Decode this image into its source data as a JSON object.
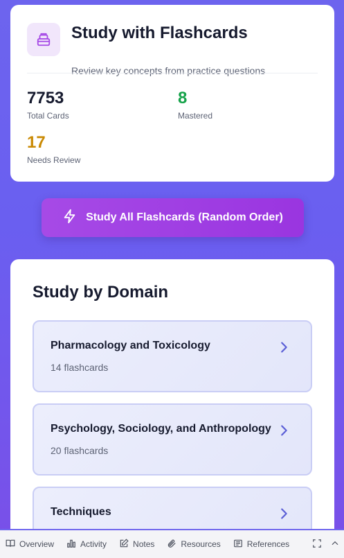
{
  "header": {
    "title": "Study with Flashcards",
    "subtitle": "Review key concepts from practice questions",
    "logo_icon": "archive-box-icon",
    "accent_color": "#a64ae6"
  },
  "stats": {
    "total": {
      "value": "7753",
      "label": "Total Cards",
      "color": "#161a2e"
    },
    "mastered": {
      "value": "8",
      "label": "Mastered",
      "color": "#16a34a"
    },
    "review": {
      "value": "17",
      "label": "Needs Review",
      "color": "#ca8a04"
    }
  },
  "study_all": {
    "label": "Study All Flashcards (Random Order)",
    "icon": "lightning-icon"
  },
  "domains": {
    "title": "Study by Domain",
    "items": [
      {
        "name": "Pharmacology and Toxicology",
        "count": "14 flashcards"
      },
      {
        "name": "Psychology, Sociology, and Anthropology",
        "count": "20 flashcards"
      },
      {
        "name": "Techniques",
        "count": ""
      }
    ]
  },
  "bottom_nav": {
    "items": [
      {
        "label": "Overview",
        "icon": "book-open-icon"
      },
      {
        "label": "Activity",
        "icon": "bar-chart-icon"
      },
      {
        "label": "Notes",
        "icon": "edit-icon"
      },
      {
        "label": "Resources",
        "icon": "paperclip-icon"
      },
      {
        "label": "References",
        "icon": "newspaper-icon"
      }
    ],
    "right_icons": [
      "expand-icon",
      "chevron-up-icon"
    ]
  }
}
